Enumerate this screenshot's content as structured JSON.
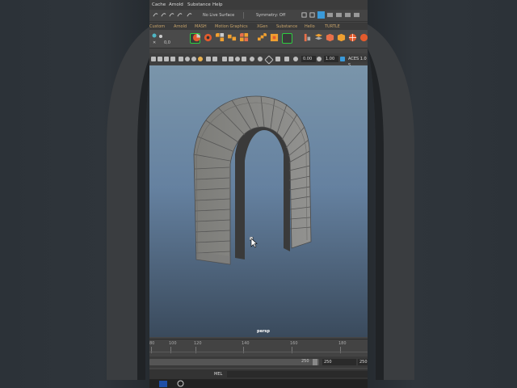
{
  "menubar": {
    "items": [
      "Cache",
      "Arnold",
      "Substance",
      "Help"
    ]
  },
  "status_line": {
    "live_surface": "No Live Surface",
    "symmetry": "Symmetry: Off"
  },
  "shelf": {
    "tabs": [
      "Custom",
      "Arnold",
      "MASH",
      "Motion Graphics",
      "XGen",
      "Substance",
      "Hello",
      "TURTLE"
    ]
  },
  "panel_toolbar": {
    "field_a": "0.00",
    "field_b": "1.00",
    "color_space": "ACES 1.0 S"
  },
  "viewport": {
    "camera_label": "persp"
  },
  "timeslider": {
    "ticks": [
      "80",
      "100",
      "120",
      "140",
      "160",
      "180"
    ]
  },
  "range": {
    "end_value": "250",
    "end_field": "250",
    "end_field2": "250"
  },
  "command_line": {
    "mode": "MEL"
  },
  "colors": {
    "viewport_top": "#7a95aa",
    "viewport_bottom": "#3a4a5c",
    "brick": "#8a8a86",
    "accent": "#3a9ad9"
  }
}
